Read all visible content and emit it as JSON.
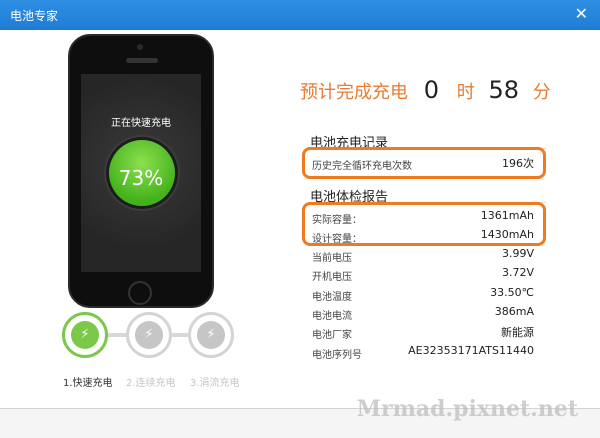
{
  "window": {
    "title": "电池专家",
    "close_glyph": "✕"
  },
  "phone": {
    "status_text": "正在快速充电",
    "percent": "73%"
  },
  "steps": [
    {
      "label": "1.快速充电",
      "icon": "plug-icon",
      "active": true
    },
    {
      "label": "2.连续充电",
      "icon": "plug-icon",
      "active": false
    },
    {
      "label": "3.涓流充电",
      "icon": "plug-icon",
      "active": false
    }
  ],
  "eta": {
    "prefix": "预计完成充电",
    "hours": "0",
    "hours_unit": "时",
    "minutes": "58",
    "minutes_unit": "分"
  },
  "charge_record": {
    "title": "电池充电记录",
    "rows": [
      {
        "label": "历史完全循环充电次数",
        "value": "196次"
      }
    ]
  },
  "battery_report": {
    "title": "电池体检报告",
    "rows": [
      {
        "label": "实际容量：",
        "value": "1361mAh"
      },
      {
        "label": "设计容量：",
        "value": "1430mAh"
      },
      {
        "label": "当前电压",
        "value": "3.99V"
      },
      {
        "label": "开机电压",
        "value": "3.72V"
      },
      {
        "label": "电池温度",
        "value": "33.50℃"
      },
      {
        "label": "电池电流",
        "value": "386mA"
      },
      {
        "label": "电池厂家",
        "value": "新能源"
      },
      {
        "label": "电池序列号",
        "value": "AE32353171ATS11440"
      }
    ]
  },
  "watermark": "Mrmad.pixnet.net",
  "colors": {
    "titlebar": "#1f7cd6",
    "accent_orange": "#e87c35",
    "highlight": "#f07a1f",
    "charge_green": "#7bc84a"
  }
}
